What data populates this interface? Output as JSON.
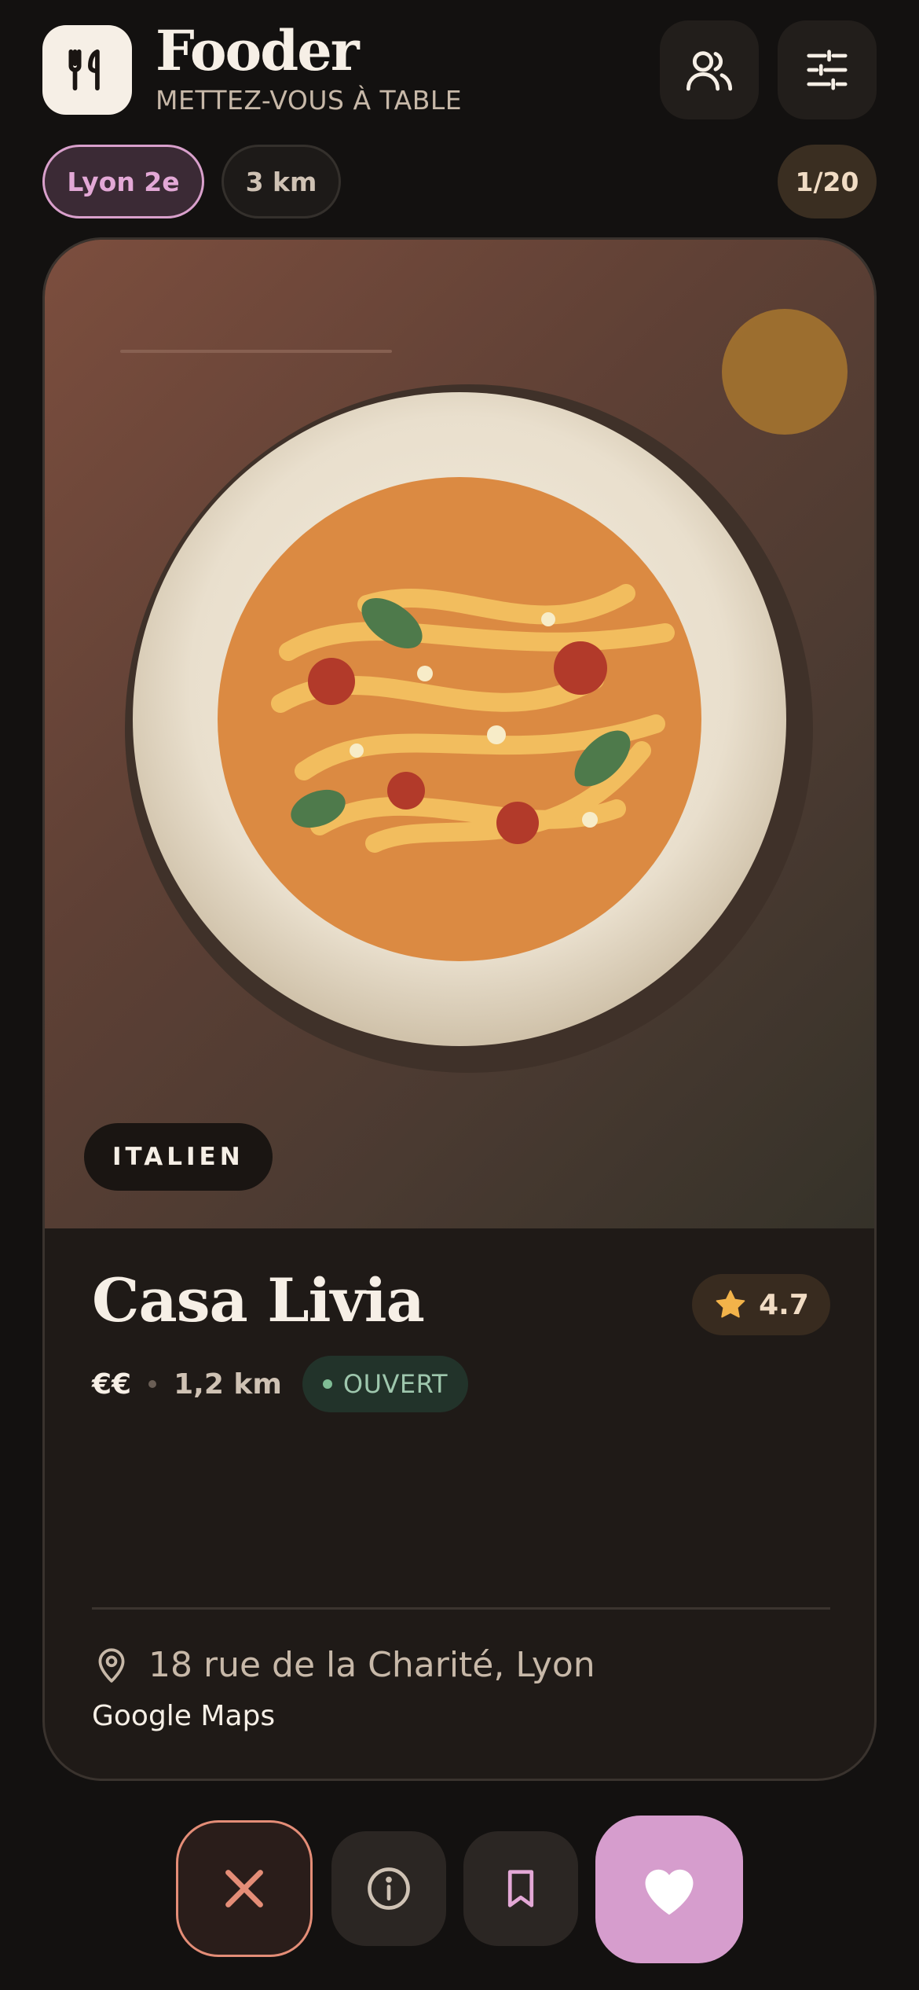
{
  "header": {
    "app_name": "Fooder",
    "tagline": "METTEZ-VOUS À TABLE",
    "logo_icon": "fork-knife-icon",
    "profile_icon": "users-icon",
    "filters_icon": "sliders-icon"
  },
  "filters": {
    "location": "Lyon 2e",
    "radius": "3 km",
    "counter": "1/20"
  },
  "card": {
    "cuisine": "ITALIEN",
    "name": "Casa Livia",
    "rating": "4.7",
    "price": "€€",
    "distance": "1,2 km",
    "status": "OUVERT",
    "address": "18 rue de la Charité, Lyon",
    "maps_link": "Google Maps"
  },
  "actions": {
    "reject_icon": "close-icon",
    "info_icon": "info-icon",
    "save_icon": "bookmark-icon",
    "like_icon": "heart-icon"
  },
  "colors": {
    "background": "#131110",
    "accent_pink": "#d69dcd",
    "reject_coral": "#e48d77",
    "star_gold": "#f2b34a",
    "open_green": "#7fbd95"
  }
}
